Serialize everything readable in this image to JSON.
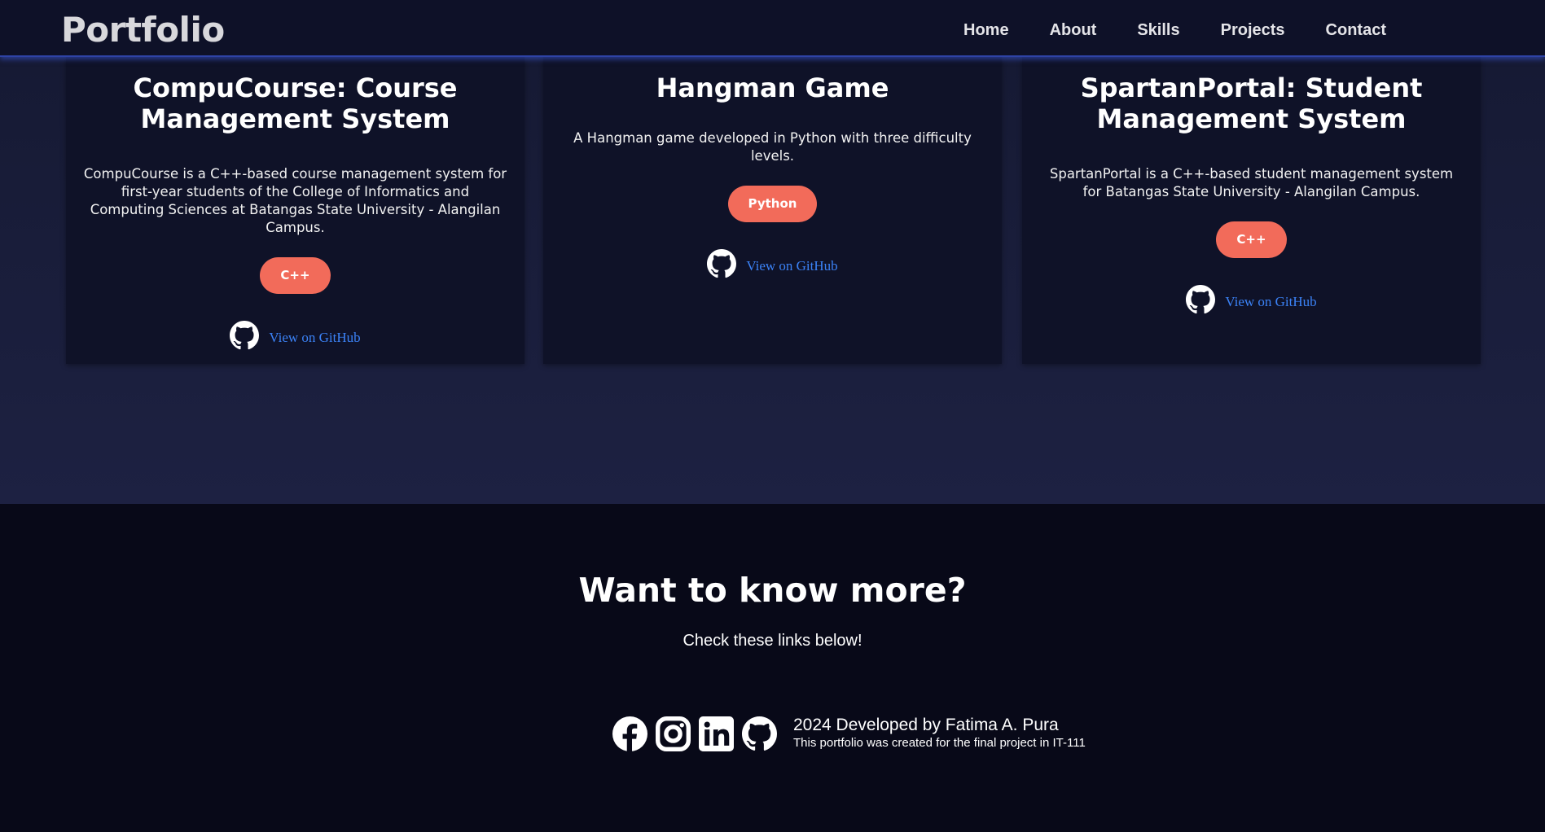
{
  "navbar": {
    "brand": "Portfolio",
    "links": [
      "Home",
      "About",
      "Skills",
      "Projects",
      "Contact"
    ]
  },
  "projects": [
    {
      "title": "CompuCourse: Course Management System",
      "description": "CompuCourse is a C++-based course management system for first-year students of the College of Informatics and Computing Sciences at Batangas State University - Alangilan Campus.",
      "tag": "C++",
      "link_label": "View on GitHub",
      "icon": "github-icon"
    },
    {
      "title": "Hangman Game",
      "description": "A Hangman game developed in Python with three difficulty levels.",
      "tag": "Python",
      "link_label": "View on GitHub",
      "icon": "github-icon"
    },
    {
      "title": "SpartanPortal: Student Management System",
      "description": "SpartanPortal is a C++-based student management system for Batangas State University - Alangilan Campus.",
      "tag": "C++",
      "link_label": "View on GitHub",
      "icon": "github-icon"
    }
  ],
  "footer": {
    "title": "Want to know more?",
    "subtitle": "Check these links below!",
    "social_icons": [
      "facebook-icon",
      "instagram-icon",
      "linkedin-icon",
      "github-icon"
    ],
    "credit": "2024 Developed by Fatima A. Pura",
    "note": "This portfolio was created for the final project in IT-111"
  },
  "colors": {
    "navbar_bg": "#0e1128",
    "section_bg": "#1b1f3a",
    "card_bg": "#0f1228",
    "tag_bg": "#f26b5a",
    "link": "#3b82f6",
    "footer_bg": "#080918"
  }
}
